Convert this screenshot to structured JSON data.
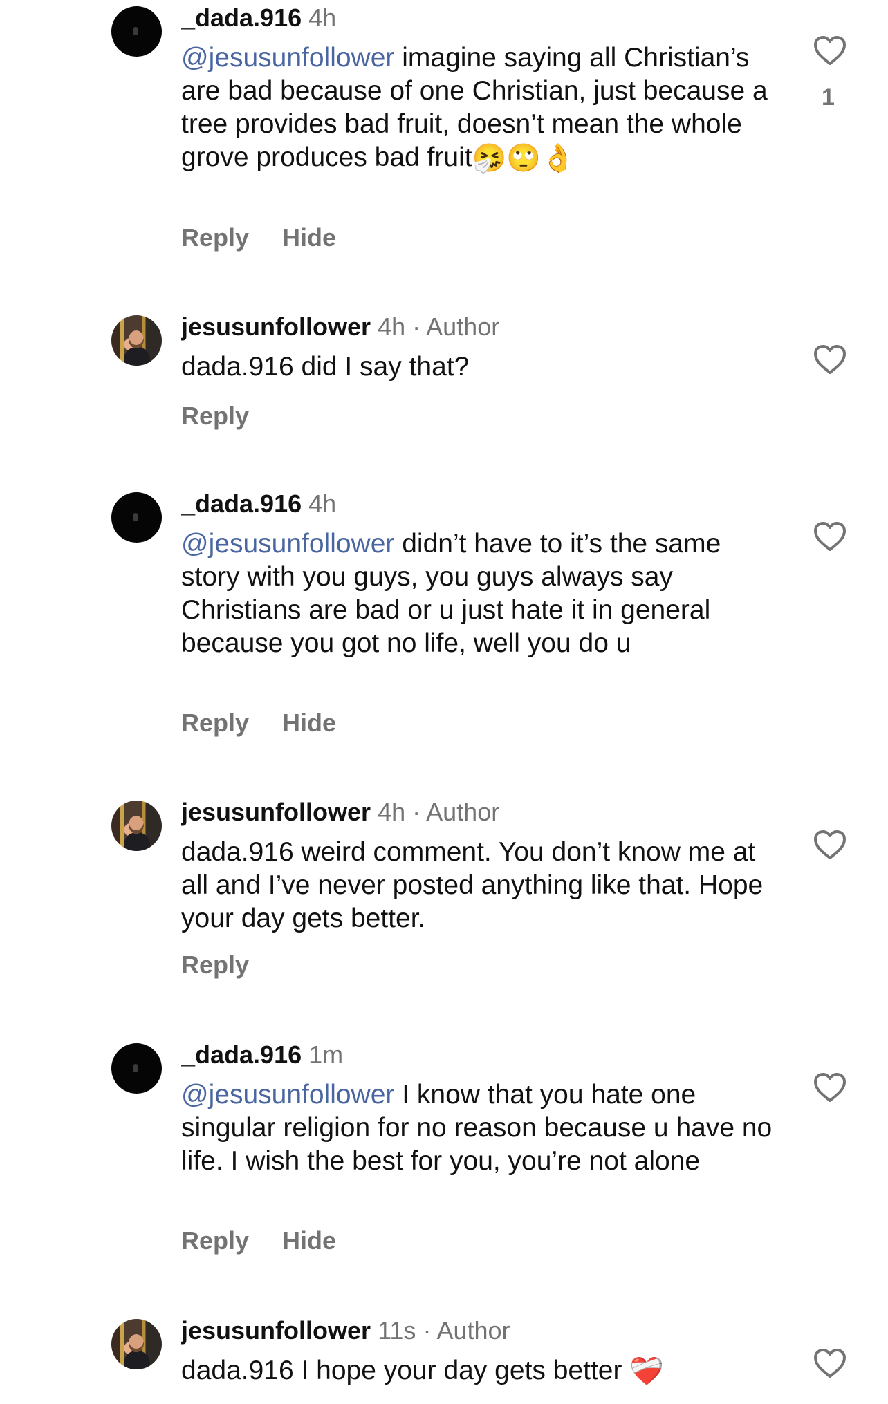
{
  "comments": [
    {
      "username": "_dada.916",
      "time": "4h",
      "author": "",
      "mention": "@jesusunfollower",
      "text": " imagine saying all Christian’s are bad because of one Christian, just because a tree provides bad fruit, doesn’t mean the whole grove produces bad fruit",
      "emojis": "🤧🙄👌",
      "reply": "Reply",
      "hide": "Hide",
      "likes": "1",
      "avatar": "dark"
    },
    {
      "username": "jesusunfollower",
      "time": "4h",
      "author": "Author",
      "mention": "",
      "text": "dada.916 did I say that?",
      "emojis": "",
      "reply": "Reply",
      "hide": "",
      "likes": "",
      "avatar": "photo"
    },
    {
      "username": "_dada.916",
      "time": "4h",
      "author": "",
      "mention": "@jesusunfollower",
      "text": " didn’t have to it’s the same story with you guys, you guys always say Christians are bad or u just hate it in general because you got no life, well you do u",
      "emojis": "",
      "reply": "Reply",
      "hide": "Hide",
      "likes": "",
      "avatar": "dark"
    },
    {
      "username": "jesusunfollower",
      "time": "4h",
      "author": "Author",
      "mention": "",
      "text": "dada.916 weird comment. You don’t know me at all and I’ve never posted anything like that. Hope your day gets better.",
      "emojis": "",
      "reply": "Reply",
      "hide": "",
      "likes": "",
      "avatar": "photo"
    },
    {
      "username": "_dada.916",
      "time": "1m",
      "author": "",
      "mention": "@jesusunfollower",
      "text": " I know that you hate one singular religion for no reason because u have no life. I wish the best for you, you’re not alone",
      "emojis": "",
      "reply": "Reply",
      "hide": "Hide",
      "likes": "",
      "avatar": "dark"
    },
    {
      "username": "jesusunfollower",
      "time": "11s",
      "author": "Author",
      "mention": "",
      "text": "dada.916 I hope your day gets better ",
      "emojis": "❤️‍🩹",
      "reply": "",
      "hide": "",
      "likes": "",
      "avatar": "photo"
    }
  ],
  "separator": "·",
  "icons": {
    "like": "heart-outline-icon"
  }
}
